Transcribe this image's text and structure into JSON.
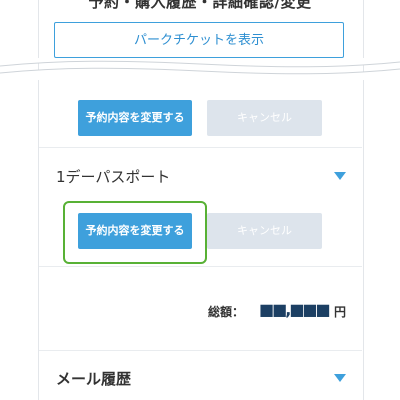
{
  "header": {
    "title": "予約・購入履歴・詳細確認/変更"
  },
  "park_ticket_button": "パークチケットを表示",
  "booking_actions_1": {
    "change_label": "予約内容を変更する",
    "cancel_label": "キャンセル"
  },
  "day_pass_section": {
    "title": "1デーパスポート",
    "toggle_icon": "triangle-down-icon",
    "change_label": "予約内容を変更する",
    "cancel_label": "キャンセル"
  },
  "total": {
    "label": "総額：",
    "amount": "■■,■■■",
    "currency": "円"
  },
  "mail_history": {
    "title": "メール履歴",
    "toggle_icon": "triangle-down-icon"
  },
  "colors": {
    "accent": "#3ea0dc",
    "disabled": "#dde4ec",
    "highlight": "#58b135",
    "amount": "#1c3f63"
  }
}
